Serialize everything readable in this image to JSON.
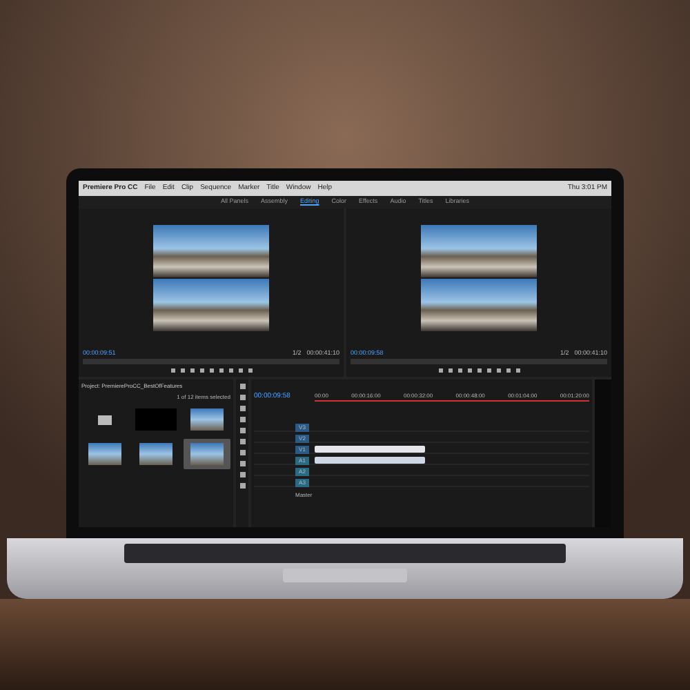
{
  "menu_bar": {
    "app": "Premiere Pro CC",
    "items": [
      "File",
      "Edit",
      "Clip",
      "Sequence",
      "Marker",
      "Title",
      "Window",
      "Help"
    ],
    "clock": "Thu 3:01 PM"
  },
  "workspace_tabs": [
    {
      "label": "All Panels",
      "selected": false
    },
    {
      "label": "Assembly",
      "selected": false
    },
    {
      "label": "Editing",
      "selected": true
    },
    {
      "label": "Color",
      "selected": false
    },
    {
      "label": "Effects",
      "selected": false
    },
    {
      "label": "Audio",
      "selected": false
    },
    {
      "label": "Titles",
      "selected": false
    },
    {
      "label": "Libraries",
      "selected": false
    }
  ],
  "source_monitor": {
    "timecode": "00:00:09:51",
    "zoom": "1/2",
    "duration": "00:00:41:10"
  },
  "program_monitor": {
    "timecode": "00:00:09:58",
    "zoom": "1/2",
    "duration": "00:00:41:10"
  },
  "project_panel": {
    "title": "Project: PremiereProCC_BestOfFeatures",
    "items_selected": "1 of 12 items selected",
    "bins": [
      {
        "kind": "folder",
        "selected": false
      },
      {
        "kind": "black",
        "selected": false
      },
      {
        "kind": "clip",
        "selected": false
      },
      {
        "kind": "clip",
        "selected": false
      },
      {
        "kind": "clip",
        "selected": false
      },
      {
        "kind": "clip",
        "selected": true
      }
    ]
  },
  "timeline": {
    "timecode": "00:00:09:58",
    "ruler": [
      "00:00",
      "00:00:16:00",
      "00:00:32:00",
      "00:00:48:00",
      "00:01:04:00",
      "00:01:20:00"
    ],
    "tracks": [
      {
        "label": "V3",
        "kind": "video",
        "clip": false
      },
      {
        "label": "V2",
        "kind": "video",
        "clip": false
      },
      {
        "label": "V1",
        "kind": "video",
        "clip": true
      },
      {
        "label": "A1",
        "kind": "audio",
        "clip": true
      },
      {
        "label": "A2",
        "kind": "audio",
        "clip": false
      },
      {
        "label": "A3",
        "kind": "audio",
        "clip": false
      }
    ],
    "master": "Master"
  }
}
